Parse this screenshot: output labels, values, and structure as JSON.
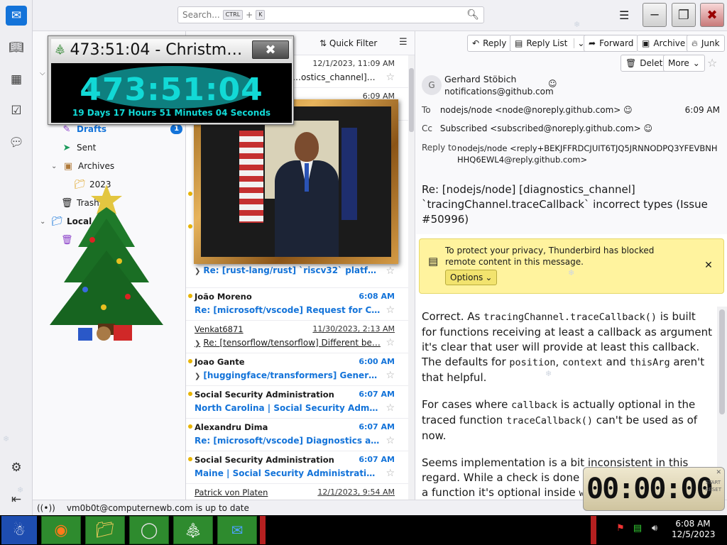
{
  "titlebar": {
    "search_placeholder": "Search...",
    "search_key1": "CTRL",
    "search_plus": "+",
    "search_key2": "K"
  },
  "spaces": [
    "mail-icon",
    "address-book-icon",
    "calendar-icon",
    "tasks-icon",
    "chat-icon"
  ],
  "folders": {
    "drafts": "Drafts",
    "drafts_count": "1",
    "sent": "Sent",
    "archives": "Archives",
    "archive_2023": "2023",
    "trash": "Trash",
    "local": "Local"
  },
  "list": {
    "quick_filter": "Quick Filter",
    "rows": [
      {
        "from": "",
        "date": "12/1/2023, 11:09 AM",
        "subject": "…ostics_channel] `tra…"
      },
      {
        "from": "",
        "date": "6:09 AM",
        "subject": ""
      },
      {
        "from": "",
        "date": "",
        "subject": "Re: [rust-lang/rust] `riscv32` platform…"
      },
      {
        "from": "João Moreno",
        "date": "6:08 AM",
        "subject": "Re: [microsoft/vscode] Request for CDN…"
      },
      {
        "from": "Venkat6871",
        "date": "11/30/2023, 2:13 AM",
        "subject": "Re: [tensorflow/tensorflow] Different be…"
      },
      {
        "from": "Joao Gante",
        "date": "6:00 AM",
        "subject": "[huggingface/transformers] Generate…"
      },
      {
        "from": "Social Security Administration",
        "date": "6:07 AM",
        "subject": "North Carolina | Social Security Adminis…"
      },
      {
        "from": "Alexandru Dima",
        "date": "6:07 AM",
        "subject": "Re: [microsoft/vscode] Diagnostics and …"
      },
      {
        "from": "Social Security Administration",
        "date": "6:07 AM",
        "subject": "Maine | Social Security Administration …"
      },
      {
        "from": "Patrick von Platen",
        "date": "12/1/2023, 9:54 AM",
        "subject": ""
      }
    ]
  },
  "reader": {
    "toolbar": {
      "reply": "Reply",
      "reply_list": "Reply List",
      "forward": "Forward",
      "archive": "Archive",
      "junk": "Junk",
      "delete": "Delete",
      "more": "More"
    },
    "avatar_letter": "G",
    "sender_name": "Gerhard Stöbich",
    "sender_email": "notifications@github.com",
    "to_label": "To",
    "to_value": "nodejs/node <node@noreply.github.com>",
    "time": "6:09 AM",
    "cc_label": "Cc",
    "cc_value": "Subscribed <subscribed@noreply.github.com>",
    "reply_to_label": "Reply to",
    "reply_to_value": "nodejs/node <reply+BEKJFFRDCJUIT6TJQ5JRNNODPQ3YFEVBNHHHQ6EWL4@reply.github.com>",
    "subject": "Re: [nodejs/node] [diagnostics_channel] `tracingChannel.traceCallback` incorrect types (Issue #50996)",
    "notice_text": "To protect your privacy, Thunderbird has blocked remote content in this message.",
    "options_label": "Options",
    "body": {
      "p1_a": "Correct. As ",
      "p1_code1": "tracingChannel.traceCallback()",
      "p1_b": " is built for functions receiving at least a callback as argument it's clear that user will provide at least this callback. The defaults for ",
      "p1_code2": "position",
      "p1_c": ", ",
      "p1_code3": "context",
      "p1_d": " and ",
      "p1_code4": "thisArg",
      "p1_e": " aren't that helpful.",
      "p2_a": "For cases where ",
      "p2_code1": "callback",
      "p2_b": " is actually optional in the traced function ",
      "p2_code2": "traceCallback()",
      "p2_c": " can't be used as of now.",
      "p3_a": "Seems implementation is a bit inconsistent in this regard. While a check is done that callback is actually a function it's optional inside ",
      "p3_code1": "wrappedCallb"
    }
  },
  "status": {
    "text": "vm0b0t@computernewb.com is up to date"
  },
  "countdown": {
    "title": "473:51:04 - Christm…",
    "big": "473:51:04",
    "detail": "19 Days 17 Hours 51 Minutes 04 Seconds"
  },
  "small_timer": {
    "digits": "00:00:00",
    "side_top": "START",
    "side_bottom": "RESET"
  },
  "taskbar": {
    "time": "6:08 AM",
    "date": "12/5/2023"
  }
}
